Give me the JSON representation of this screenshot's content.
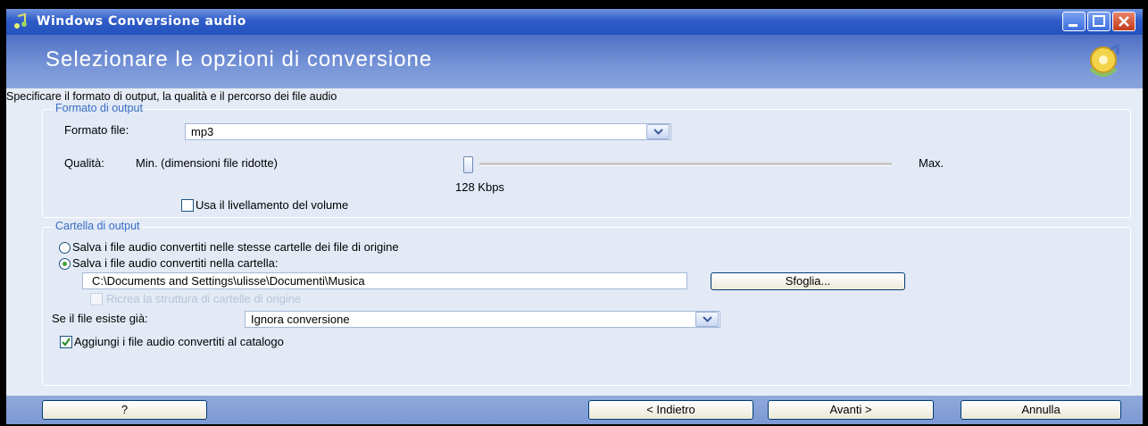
{
  "window": {
    "title": "Windows Conversione audio",
    "header_title": "Selezionare le opzioni di conversione",
    "subtitle": "Specificare il formato di output, la qualità e il percorso dei file audio"
  },
  "output_format": {
    "legend": "Formato di output",
    "file_format_label": "Formato file:",
    "file_format_value": "mp3",
    "quality_label": "Qualità:",
    "quality_min_label": "Min. (dimensioni file ridotte)",
    "quality_max_label": "Max.",
    "quality_level": 0,
    "bitrate_label": "128 Kbps",
    "volume_leveling_label": "Usa il livellamento del volume",
    "volume_leveling_checked": false
  },
  "output_folder": {
    "legend": "Cartella di output",
    "option_same_folder": "Salva i file audio convertiti nelle stesse cartelle dei file di origine",
    "option_custom_folder": "Salva i file audio convertiti nella cartella:",
    "selected_option": "custom_folder",
    "path_value": "C:\\Documents and Settings\\ulisse\\Documenti\\Musica",
    "browse_label": "Sfoglia...",
    "recreate_structure_label": "Ricrea la struttura di cartelle di origine",
    "recreate_structure_enabled": false,
    "if_exists_label": "Se il file esiste già:",
    "if_exists_value": "Ignora conversione",
    "add_to_catalog_label": "Aggiungi i file audio convertiti al catalogo",
    "add_to_catalog_checked": true
  },
  "footer": {
    "help_label": "?",
    "back_label": "< Indietro",
    "next_label": "Avanti >",
    "cancel_label": "Annulla"
  },
  "icons": {
    "app": "music-note-icon",
    "header": "audio-conversion-icon",
    "minimize": "minimize-icon",
    "maximize": "maximize-icon",
    "close": "close-icon",
    "dropdown": "chevron-down-icon",
    "check": "checkmark-icon"
  },
  "colors": {
    "titlebar": "#2553bd",
    "header": "#7593d6",
    "panel": "#e3eaf6",
    "legend_text": "#3a6ec3",
    "radio_selected": "#3fa23a",
    "check_mark": "#2f8f2f"
  }
}
